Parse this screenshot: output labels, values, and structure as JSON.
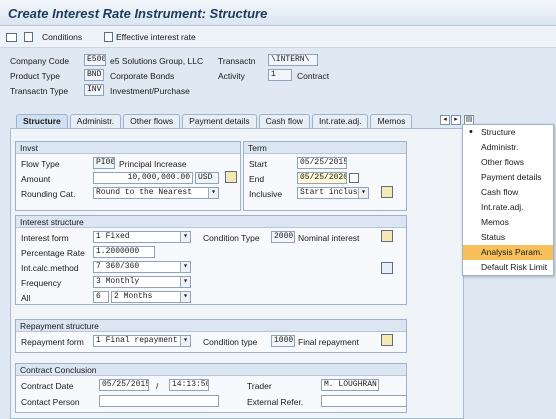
{
  "window": {
    "title": "Create Interest Rate Instrument: Structure"
  },
  "toolbar": {
    "conditions_label": "Conditions",
    "effective_label": "Effective interest rate"
  },
  "header": {
    "company_code_label": "Company Code",
    "company_code": "E500",
    "company_name": "e5 Solutions Group, LLC",
    "product_type_label": "Product Type",
    "product_type": "BND",
    "product_name": "Corporate Bonds",
    "transaction_type_label": "Transactn Type",
    "transaction_type": "INV",
    "transaction_type_name": "Investment/Purchase",
    "transaction_label": "Transactn",
    "transaction": "\\INTERN\\",
    "activity_label": "Activity",
    "activity": "1",
    "activity_name": "Contract"
  },
  "tabs": [
    {
      "label": "Structure"
    },
    {
      "label": "Administr."
    },
    {
      "label": "Other flows"
    },
    {
      "label": "Payment details"
    },
    {
      "label": "Cash flow"
    },
    {
      "label": "Int.rate.adj."
    },
    {
      "label": "Memos"
    }
  ],
  "invst": {
    "title": "Invst",
    "flow_type_label": "Flow Type",
    "flow_type": "PI00",
    "flow_type_name": "Principal Increase",
    "amount_label": "Amount",
    "amount": "10,000,000.00",
    "currency": "USD",
    "rounding_label": "Rounding Cat.",
    "rounding": "Round to the Nearest"
  },
  "term": {
    "title": "Term",
    "start_label": "Start",
    "start": "05/25/2015",
    "end_label": "End",
    "end": "05/25/2020",
    "inclusive_label": "Inclusive",
    "inclusive": "Start inclusive"
  },
  "interest": {
    "title": "Interest structure",
    "form_label": "Interest form",
    "form": "1 Fixed",
    "condition_type_label": "Condition Type",
    "condition_type": "2000",
    "condition_type_name": "Nominal interest",
    "percentage_label": "Percentage Rate",
    "percentage": "1.2000000",
    "calc_label": "Int.calc.method",
    "calc": "7 360/360",
    "frequency_label": "Frequency",
    "frequency": "3 Monthly",
    "all_label": "All",
    "all_value": "6",
    "all_unit": "2 Months"
  },
  "repayment": {
    "title": "Repayment structure",
    "form_label": "Repayment form",
    "form": "1 Final repayment",
    "condition_type_label": "Condition type",
    "condition_type": "1000",
    "condition_type_name": "Final repayment"
  },
  "contract": {
    "title": "Contract Conclusion",
    "date_label": "Contract Date",
    "date": "05/25/2015",
    "separator": "/",
    "time": "14:13:50",
    "trader_label": "Trader",
    "trader": "M. LOUGHRAN",
    "person_label": "Contact Person",
    "person": "",
    "ext_label": "External Refer.",
    "ext": ""
  },
  "tab_menu": {
    "items": [
      {
        "label": "Structure"
      },
      {
        "label": "Administr."
      },
      {
        "label": "Other flows"
      },
      {
        "label": "Payment details"
      },
      {
        "label": "Cash flow"
      },
      {
        "label": "Int.rate.adj."
      },
      {
        "label": "Memos"
      },
      {
        "label": "Status"
      },
      {
        "label": "Analysis Param."
      },
      {
        "label": "Default Risk Limit"
      }
    ]
  }
}
